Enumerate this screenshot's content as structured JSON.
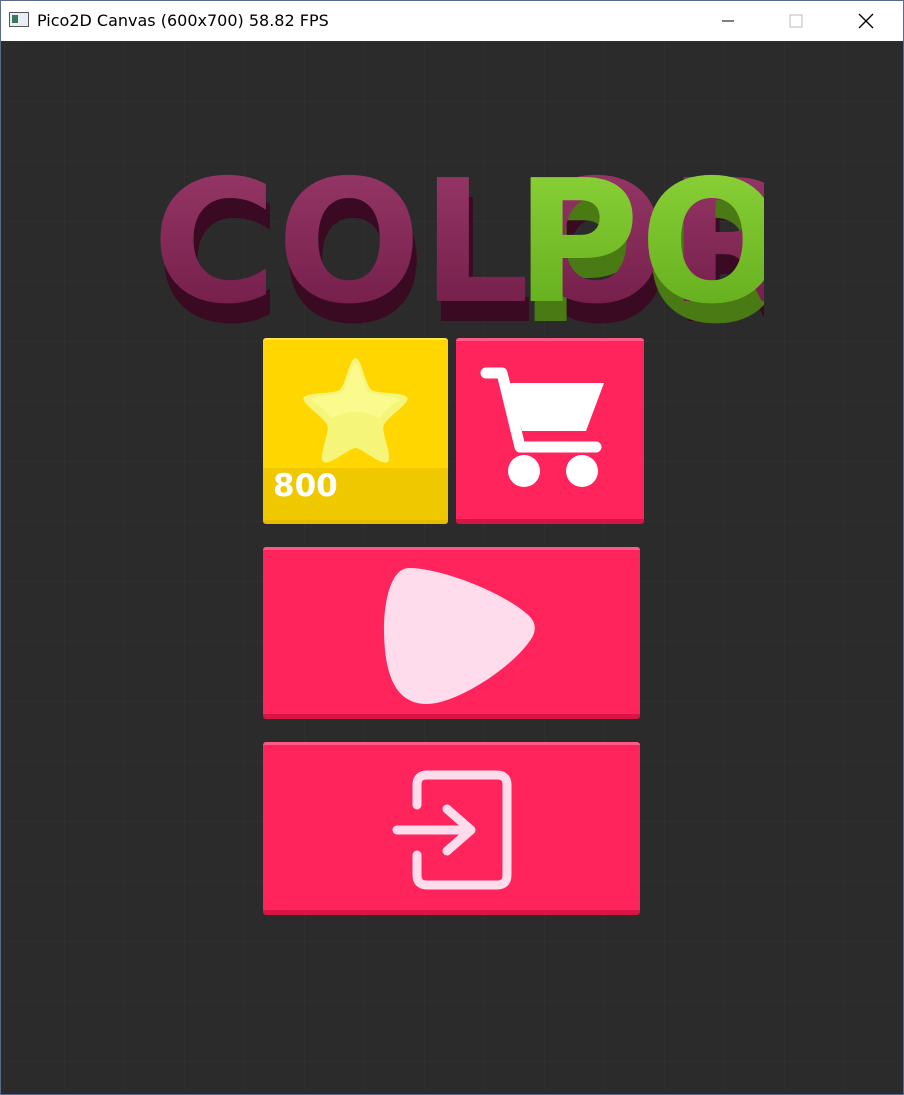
{
  "window": {
    "title": "Pico2D Canvas (600x700) 58.82 FPS",
    "controls": {
      "minimize": "minimize-icon",
      "maximize": "maximize-icon",
      "close": "close-icon"
    }
  },
  "game": {
    "logo": {
      "word1": "COLOR",
      "word2": "POP!",
      "word1_color": "#8a2a5a",
      "word2_color": "#7fc42a"
    },
    "stars": {
      "count": "800",
      "icon": "star-icon"
    },
    "shop": {
      "icon": "cart-icon"
    },
    "play": {
      "icon": "play-icon"
    },
    "exit": {
      "icon": "exit-icon"
    },
    "colors": {
      "accent": "#ff245c",
      "gold": "#ffd600",
      "background": "#2b2b2b"
    }
  }
}
